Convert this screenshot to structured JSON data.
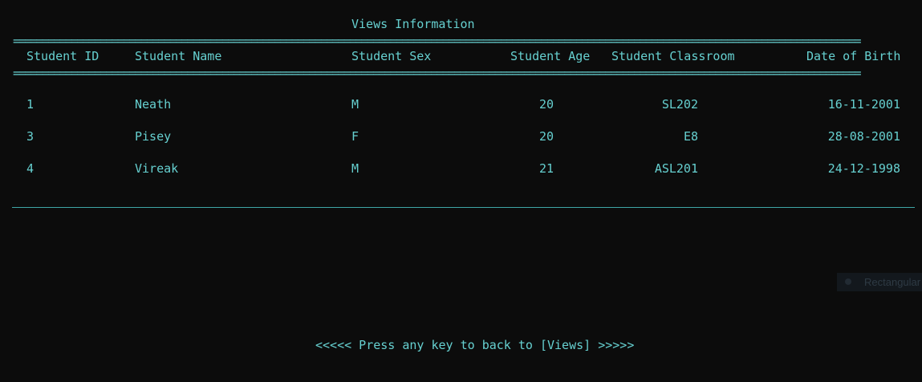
{
  "title": "Views Information",
  "separator": "==================================================================================================================================================",
  "columns": {
    "id": "Student ID",
    "name": "Student Name",
    "sex": "Student Sex",
    "age": "Student Age",
    "classroom": "Student Classroom",
    "dob": "Date of Birth"
  },
  "rows": [
    {
      "id": "1",
      "name": "Neath",
      "sex": "M",
      "age": "20",
      "classroom": "SL202",
      "dob": "16-11-2001"
    },
    {
      "id": "3",
      "name": "Pisey",
      "sex": "F",
      "age": "20",
      "classroom": "E8",
      "dob": "28-08-2001"
    },
    {
      "id": "4",
      "name": "Vireak",
      "sex": "M",
      "age": "21",
      "classroom": "ASL201",
      "dob": "24-12-1998"
    }
  ],
  "footer": "<<<<< Press any key to back to [Views] >>>>>",
  "overlay": {
    "label": "Rectangular"
  },
  "colors": {
    "background": "#0c0c0c",
    "text": "#66d0d0"
  }
}
